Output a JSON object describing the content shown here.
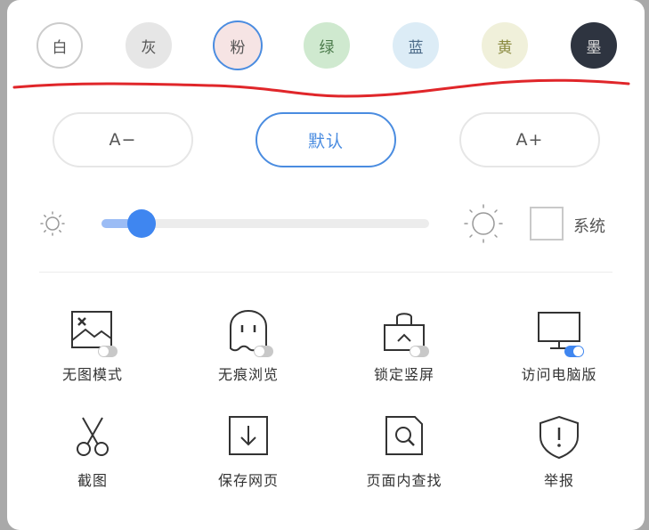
{
  "themes": [
    {
      "label": "白",
      "bg": "#ffffff",
      "border": "#cccccc",
      "text": "#555555"
    },
    {
      "label": "灰",
      "bg": "#e6e6e6",
      "border": "#e6e6e6",
      "text": "#555555"
    },
    {
      "label": "粉",
      "bg": "#f6e4e4",
      "border": "#f6e4e4",
      "text": "#555555",
      "selected": true
    },
    {
      "label": "绿",
      "bg": "#cfe9cf",
      "border": "#cfe9cf",
      "text": "#4a7a4a"
    },
    {
      "label": "蓝",
      "bg": "#dcecf6",
      "border": "#dcecf6",
      "text": "#4b6a88"
    },
    {
      "label": "黄",
      "bg": "#f0f0da",
      "border": "#f0f0da",
      "text": "#8a8a40"
    },
    {
      "label": "墨",
      "bg": "#2e3440",
      "border": "#2e3440",
      "text": "#dddddd"
    }
  ],
  "font_size": {
    "decrease_label": "A−",
    "default_label": "默认",
    "increase_label": "A+"
  },
  "brightness": {
    "level": 0.1,
    "system_label": "系统",
    "system_checked": false
  },
  "tools": [
    {
      "label": "无图模式",
      "icon": "image-icon",
      "toggle": false
    },
    {
      "label": "无痕浏览",
      "icon": "ghost-icon",
      "toggle": false
    },
    {
      "label": "锁定竖屏",
      "icon": "lock-screen-icon",
      "toggle": false
    },
    {
      "label": "访问电脑版",
      "icon": "monitor-icon",
      "toggle": true
    },
    {
      "label": "截图",
      "icon": "scissors-icon"
    },
    {
      "label": "保存网页",
      "icon": "download-icon"
    },
    {
      "label": "页面内查找",
      "icon": "find-in-page-icon"
    },
    {
      "label": "举报",
      "icon": "report-shield-icon"
    }
  ],
  "colors": {
    "accent": "#3f86f0",
    "accent_light": "#9bbcf5",
    "selected_border": "#4a8ce0",
    "annotation_red": "#e0262a"
  }
}
